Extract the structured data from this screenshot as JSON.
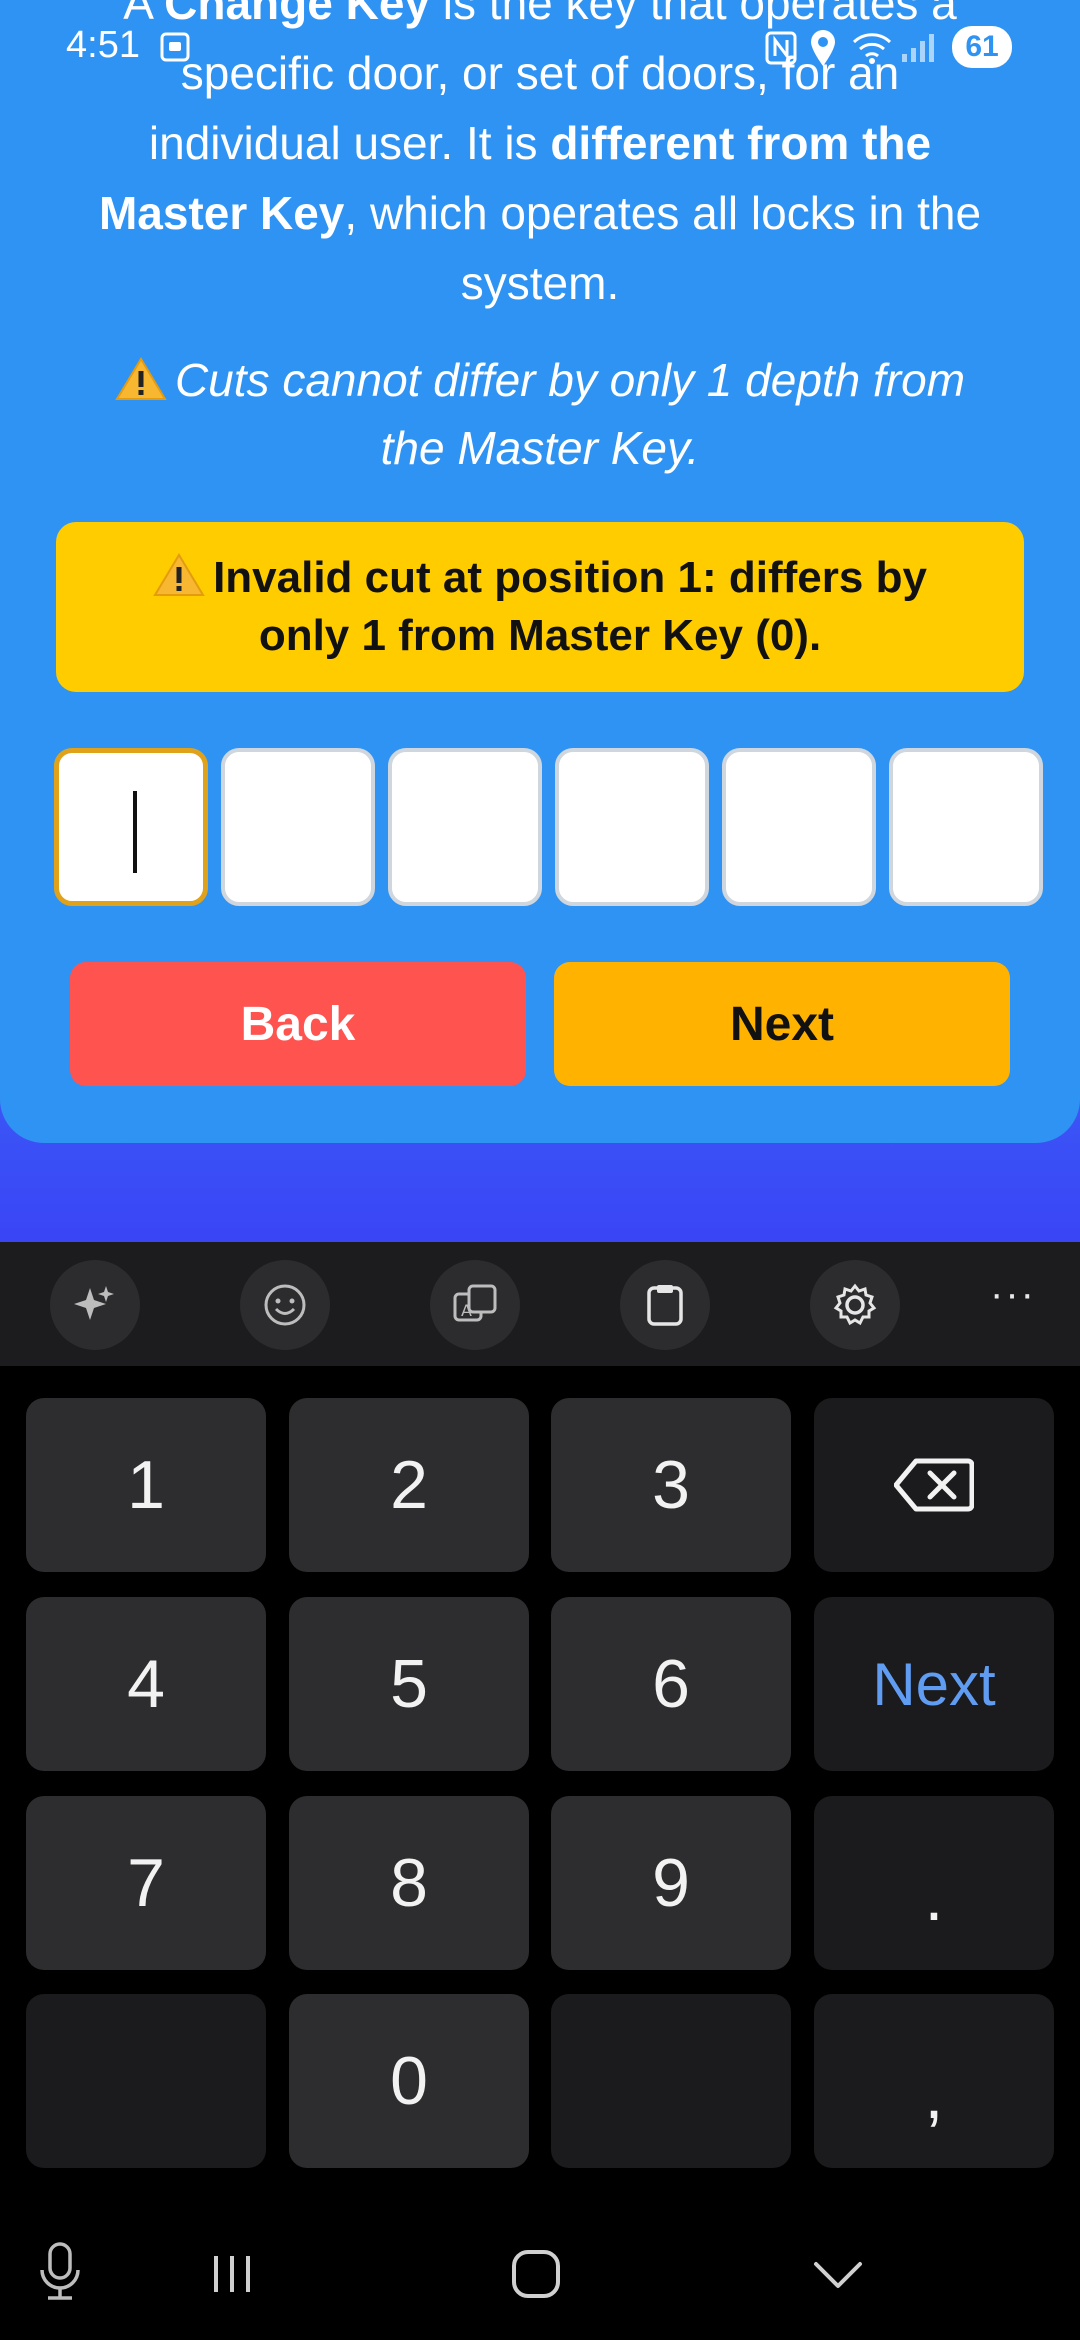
{
  "status_bar": {
    "time": "4:51",
    "battery": "61"
  },
  "info": {
    "line1_a": "A ",
    "line1_b": "Change Key",
    "line1_c": " is the key that operates a",
    "line2": "specific door, or set of doors, for an",
    "line3_a": "individual user. It is ",
    "line3_b": "different from the",
    "line4_a": "Master Key",
    "line4_b": ", which operates all locks in the",
    "line5": "system."
  },
  "warning_note": {
    "line1": "Cuts cannot differ by only 1 depth from",
    "line2": "the Master Key."
  },
  "error_box": {
    "line1": "Invalid cut at position 1: differs by",
    "line2": "only 1 from Master Key (0)."
  },
  "cuts": [
    "",
    "",
    "",
    "",
    "",
    ""
  ],
  "buttons": {
    "back": "Back",
    "next": "Next"
  },
  "keyboard": {
    "toolbar_icons": [
      "sparkle-icon",
      "emoji-icon",
      "translate-icon",
      "clipboard-icon",
      "gear-icon",
      "more-icon"
    ],
    "more_label": "···",
    "keys": {
      "k1": "1",
      "k2": "2",
      "k3": "3",
      "k4": "4",
      "k5": "5",
      "k6": "6",
      "next": "Next",
      "k7": "7",
      "k8": "8",
      "k9": "9",
      "dot": ".",
      "k0": "0",
      "comma": ","
    }
  }
}
